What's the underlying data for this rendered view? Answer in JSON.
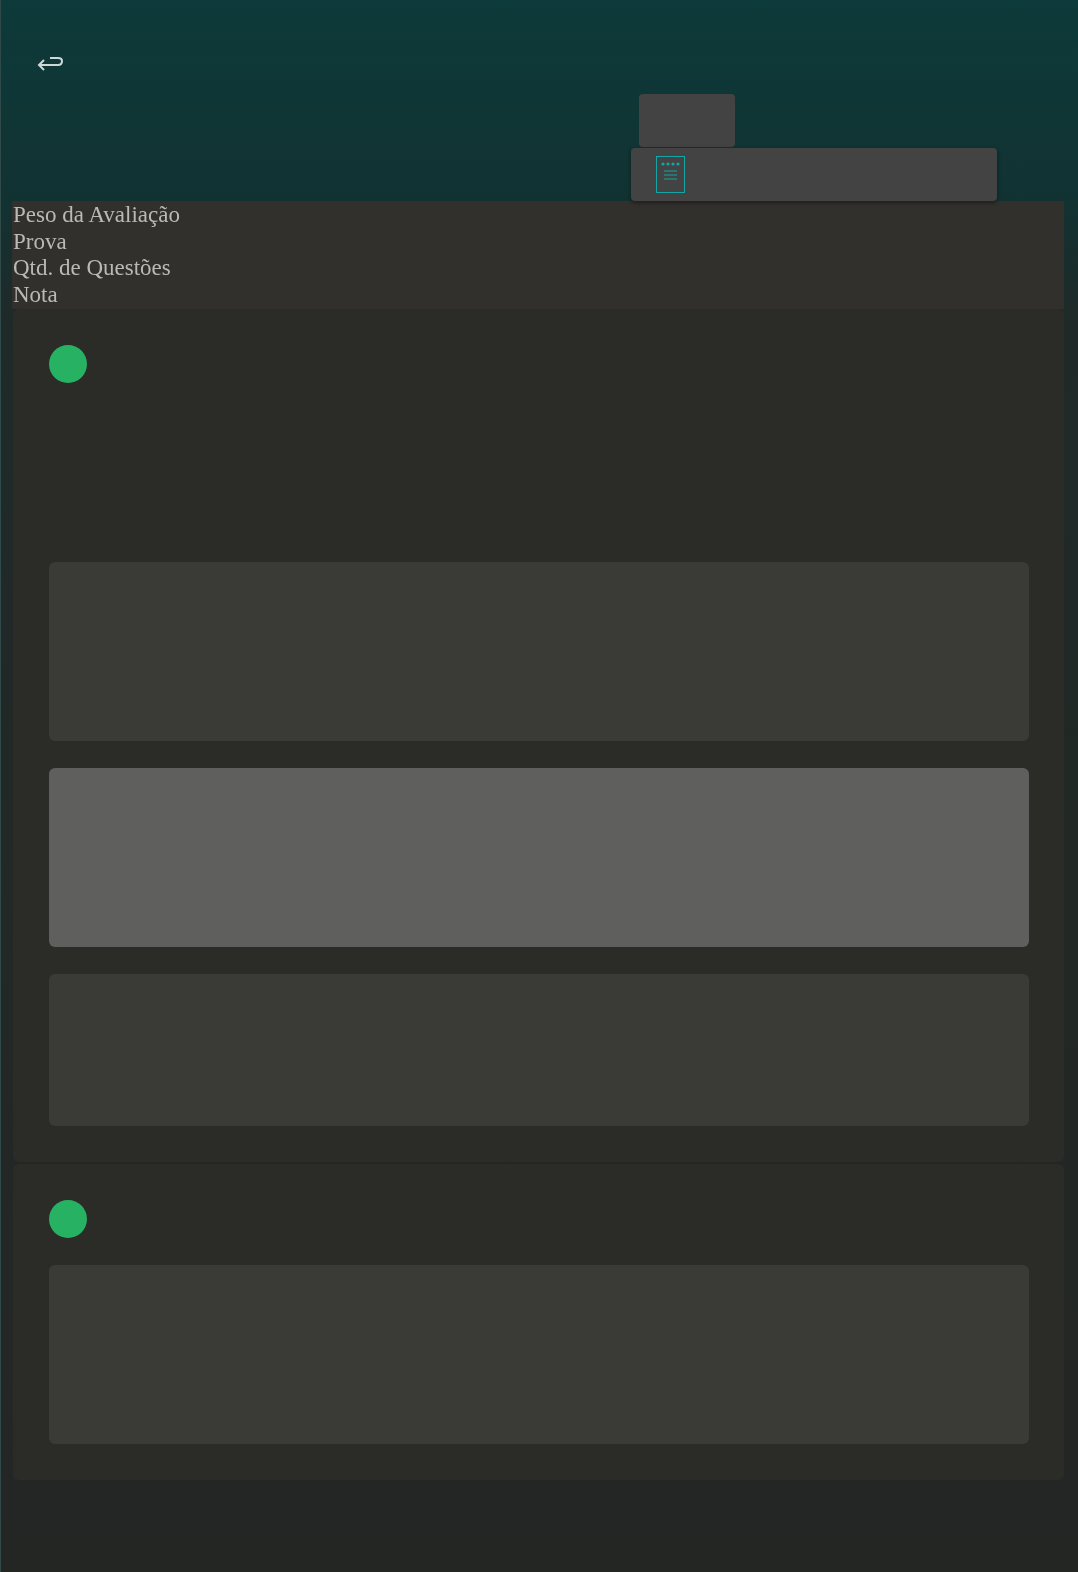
{
  "header_labels": [
    "Peso da Avaliação",
    "Prova",
    "Qtd. de Questões",
    "Nota"
  ],
  "cards": [
    {
      "color": "#27b263",
      "blocks": [
        {
          "selected": false
        },
        {
          "selected": true
        },
        {
          "selected": false
        }
      ]
    },
    {
      "color": "#27b263",
      "blocks": [
        {
          "selected": false
        }
      ]
    }
  ]
}
